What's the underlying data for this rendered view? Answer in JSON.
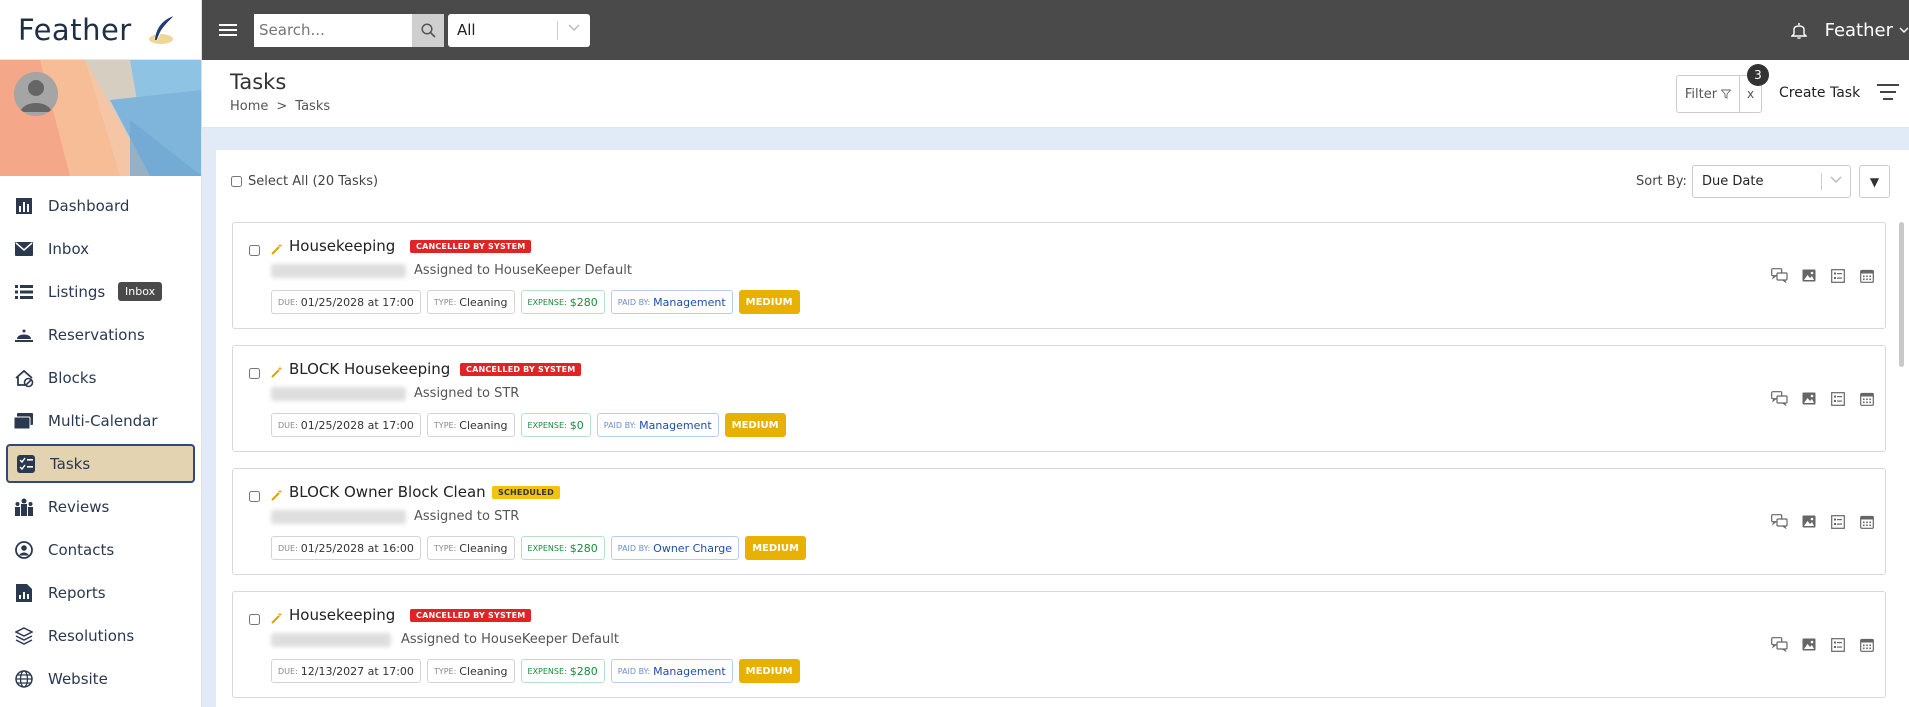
{
  "app": {
    "name": "Feather"
  },
  "topbar": {
    "search_placeholder": "Search...",
    "scope": "All",
    "user": "Feather"
  },
  "sidebar": {
    "tooltip": "Inbox",
    "items": [
      {
        "label": "Dashboard",
        "icon": "bar-chart-icon"
      },
      {
        "label": "Inbox",
        "icon": "envelope-icon"
      },
      {
        "label": "Listings",
        "icon": "list-icon"
      },
      {
        "label": "Reservations",
        "icon": "bell-service-icon"
      },
      {
        "label": "Blocks",
        "icon": "home-block-icon"
      },
      {
        "label": "Multi-Calendar",
        "icon": "calendar-stack-icon"
      },
      {
        "label": "Tasks",
        "icon": "tasks-icon",
        "active": true
      },
      {
        "label": "Reviews",
        "icon": "people-icon"
      },
      {
        "label": "Contacts",
        "icon": "contact-icon"
      },
      {
        "label": "Reports",
        "icon": "report-icon"
      },
      {
        "label": "Resolutions",
        "icon": "layers-icon"
      },
      {
        "label": "Website",
        "icon": "globe-icon"
      }
    ]
  },
  "header": {
    "title": "Tasks",
    "breadcrumb": {
      "home": "Home",
      "sep": ">",
      "current": "Tasks"
    },
    "filter_label": "Filter",
    "filter_clear": "x",
    "filter_count": "3",
    "create_task": "Create Task"
  },
  "toolbar": {
    "select_all": "Select All (20 Tasks)",
    "sort_label": "Sort By:",
    "sort_value": "Due Date",
    "sort_dir": "▼"
  },
  "tasks": [
    {
      "title": "Housekeeping",
      "status": "CANCELLED BY SYSTEM",
      "assigned": "Assigned to HouseKeeper Default",
      "due_key": "DUE:",
      "due": "01/25/2028 at 17:00",
      "type_key": "TYPE:",
      "type": "Cleaning",
      "expense_key": "EXPENSE:",
      "expense": "$280",
      "paid_key": "PAID BY:",
      "paid": "Management",
      "priority": "MEDIUM"
    },
    {
      "title": "BLOCK Housekeeping",
      "status": "CANCELLED BY SYSTEM",
      "assigned": "Assigned to STR",
      "due_key": "DUE:",
      "due": "01/25/2028 at 17:00",
      "type_key": "TYPE:",
      "type": "Cleaning",
      "expense_key": "EXPENSE:",
      "expense": "$0",
      "paid_key": "PAID BY:",
      "paid": "Management",
      "priority": "MEDIUM"
    },
    {
      "title": "BLOCK Owner Block Clean",
      "status": "SCHEDULED",
      "assigned": "Assigned to STR",
      "due_key": "DUE:",
      "due": "01/25/2028 at 16:00",
      "type_key": "TYPE:",
      "type": "Cleaning",
      "expense_key": "EXPENSE:",
      "expense": "$280",
      "paid_key": "PAID BY:",
      "paid": "Owner Charge",
      "priority": "MEDIUM"
    },
    {
      "title": "Housekeeping",
      "status": "CANCELLED BY SYSTEM",
      "assigned": "Assigned to HouseKeeper Default",
      "due_key": "DUE:",
      "due": "12/13/2027 at 17:00",
      "type_key": "TYPE:",
      "type": "Cleaning",
      "expense_key": "EXPENSE:",
      "expense": "$280",
      "paid_key": "PAID BY:",
      "paid": "Management",
      "priority": "MEDIUM"
    }
  ]
}
